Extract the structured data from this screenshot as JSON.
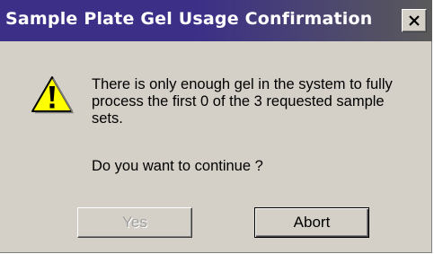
{
  "window": {
    "title": "Sample Plate Gel Usage Confirmation",
    "close_icon": "close-icon"
  },
  "dialog": {
    "icon": "warning-icon",
    "message": "There is only enough gel in the system to fully process the first 0 of the 3 requested sample sets.",
    "question": "Do you want to continue ?"
  },
  "buttons": {
    "yes_label": "Yes",
    "yes_enabled": false,
    "abort_label": "Abort",
    "abort_default": true
  },
  "colors": {
    "titlebar_start": "#3b2f88",
    "titlebar_end": "#5a5a5a",
    "dialog_face": "#d4d0c8",
    "warning_fill": "#ffff00"
  }
}
